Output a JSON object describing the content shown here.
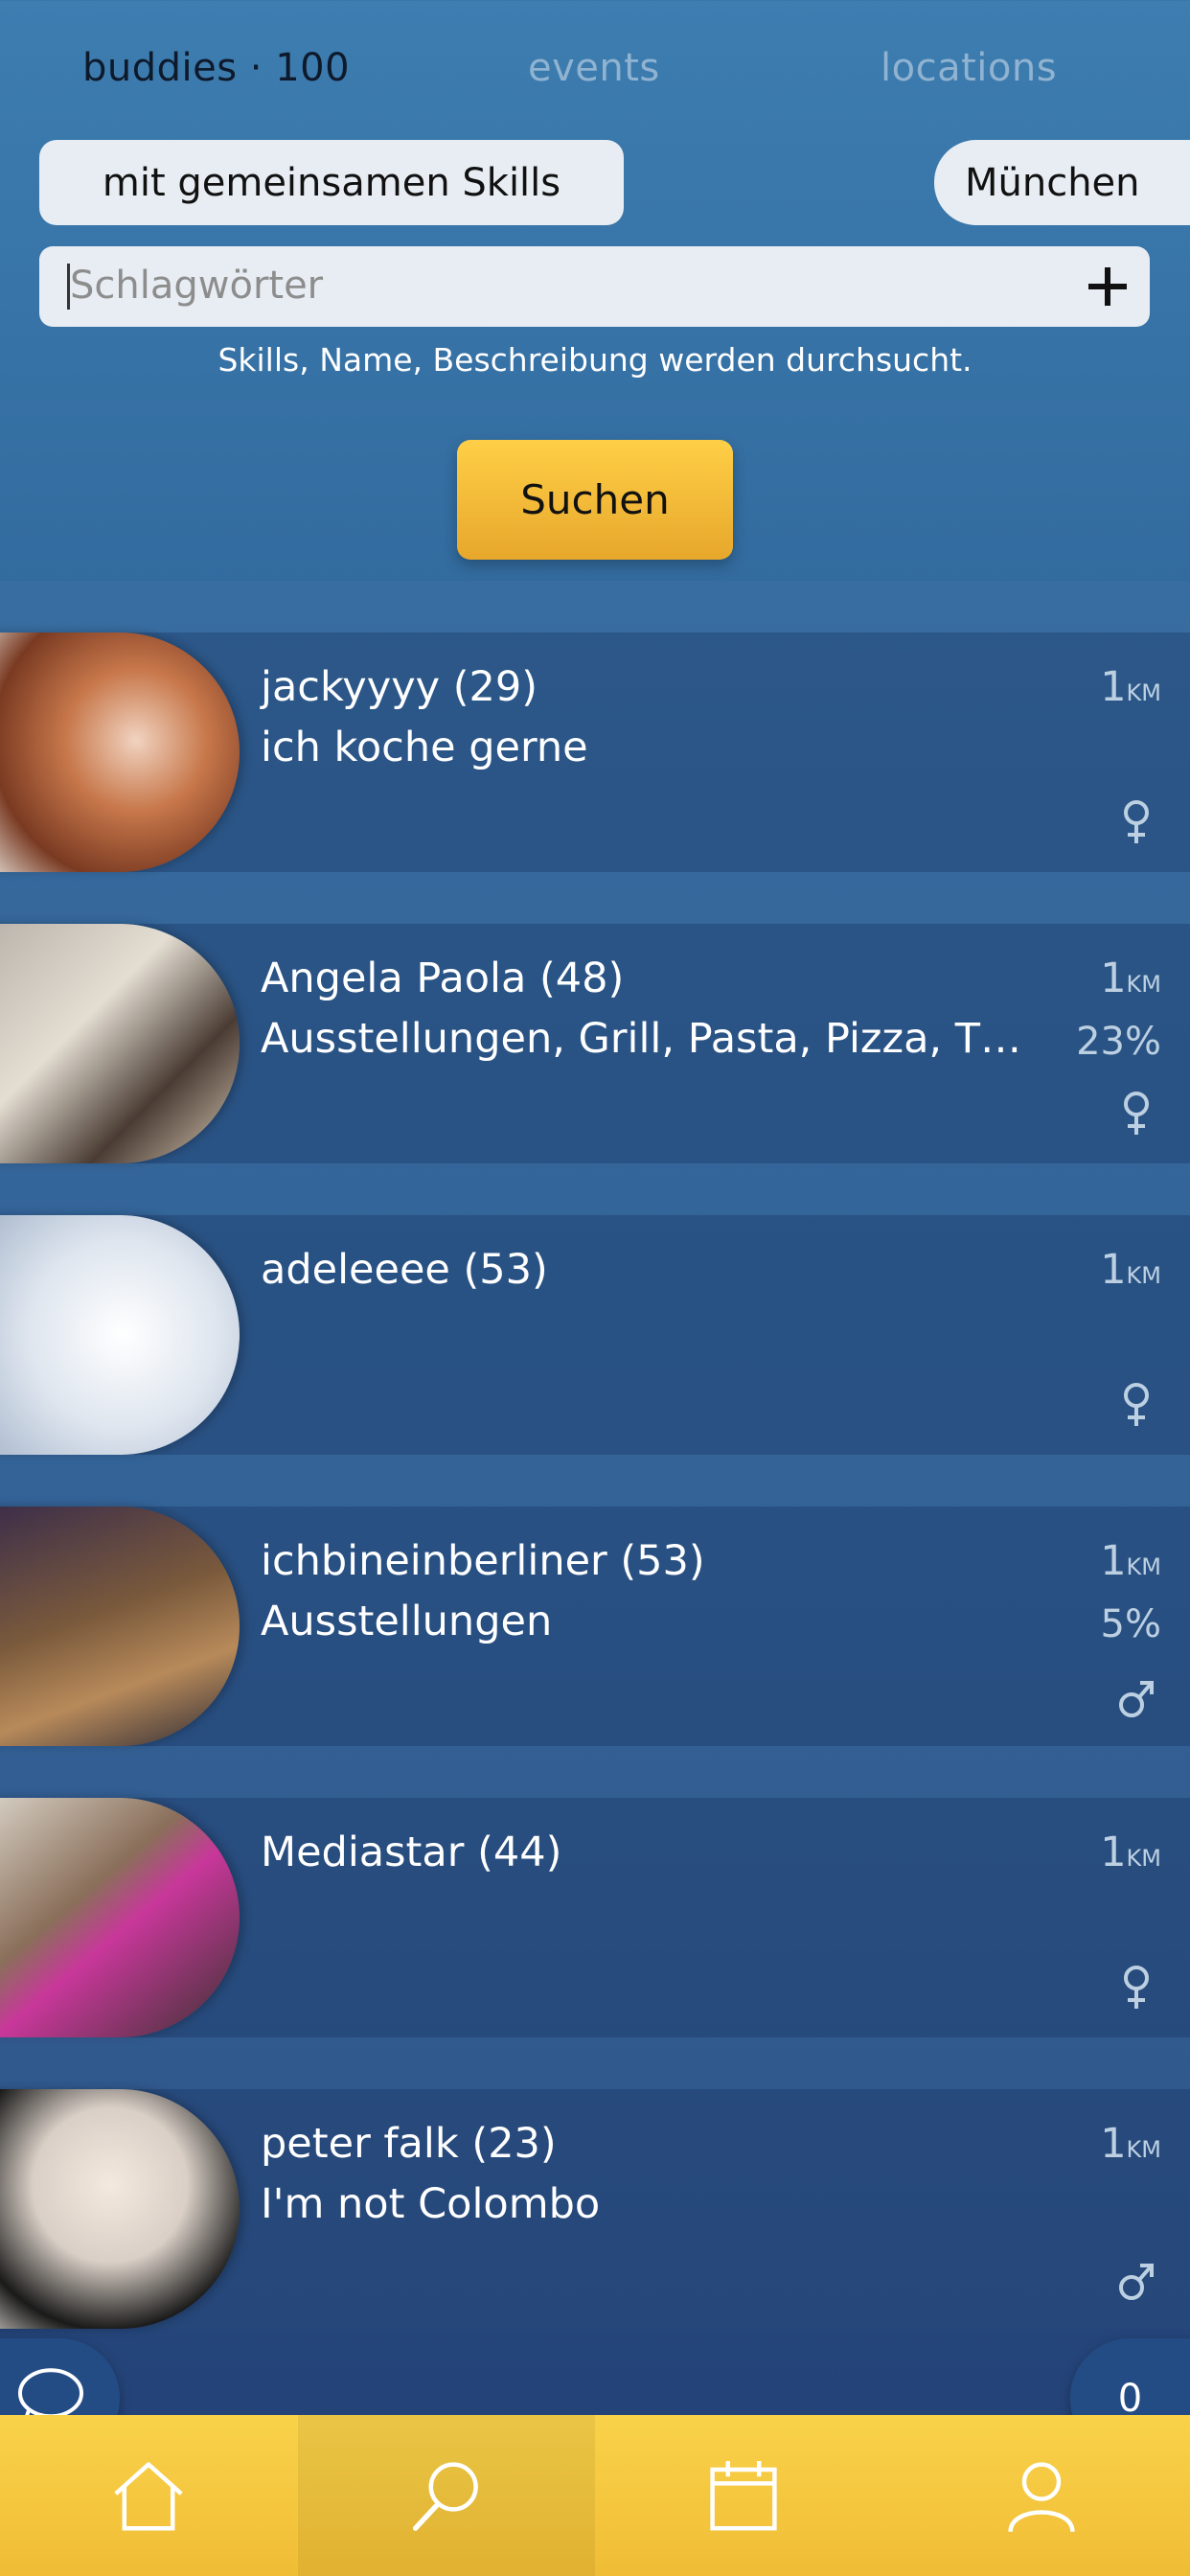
{
  "tabs": [
    {
      "label": "buddies · 100",
      "active": true
    },
    {
      "label": "events",
      "active": false
    },
    {
      "label": "locations",
      "active": false
    }
  ],
  "filters": {
    "skills_filter": "mit gemeinsamen Skills",
    "city_filter": "München"
  },
  "search": {
    "placeholder": "Schlagwörter",
    "hint": "Skills, Name, Beschreibung werden durchsucht.",
    "button_label": "Suchen"
  },
  "buddies": [
    {
      "name": "jackyyyy (29)",
      "description": "ich koche gerne",
      "distance": "1",
      "unit": "KM",
      "match": "",
      "gender": "female"
    },
    {
      "name": "Angela Paola (48)",
      "description": "Ausstellungen, Grill, Pasta, Pizza, Th...",
      "distance": "1",
      "unit": "KM",
      "match": "23%",
      "gender": "female"
    },
    {
      "name": "adeleeee (53)",
      "description": "",
      "distance": "1",
      "unit": "KM",
      "match": "",
      "gender": "female"
    },
    {
      "name": "ichbineinberliner (53)",
      "description": "Ausstellungen",
      "distance": "1",
      "unit": "KM",
      "match": "5%",
      "gender": "male"
    },
    {
      "name": "Mediastar (44)",
      "description": "",
      "distance": "1",
      "unit": "KM",
      "match": "",
      "gender": "female"
    },
    {
      "name": "peter falk (23)",
      "description": "I'm not Colombo",
      "distance": "1",
      "unit": "KM",
      "match": "",
      "gender": "male"
    }
  ],
  "chat_badge_count": "0",
  "nav": [
    "home-icon",
    "search-icon",
    "calendar-icon",
    "profile-icon"
  ],
  "colors": {
    "accent": "#f5c33b",
    "background": "#2f6599"
  }
}
